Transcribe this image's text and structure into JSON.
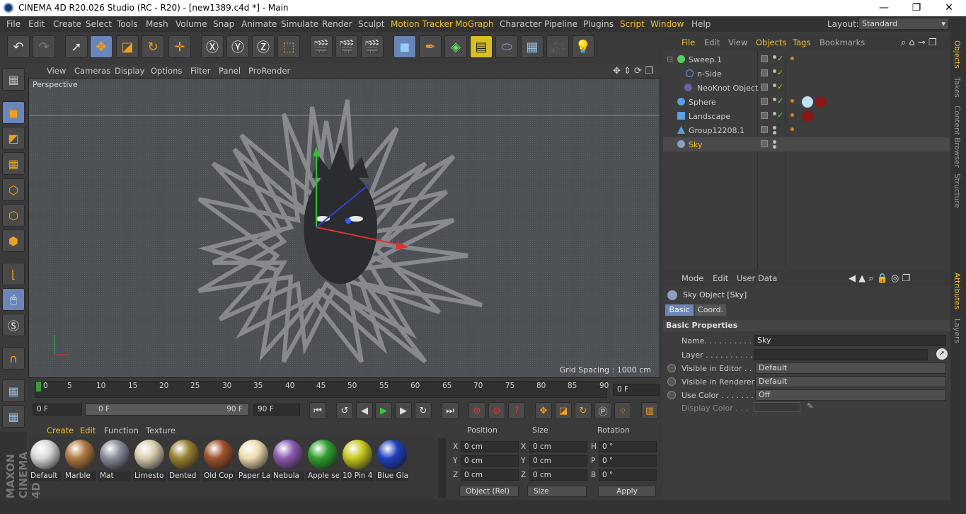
{
  "window": {
    "title": "CINEMA 4D R20.026 Studio (RC - R20) - [new1389.c4d *] - Main",
    "min": "—",
    "max": "❐",
    "close": "✕"
  },
  "menu": [
    "File",
    "Edit",
    "Create",
    "Select",
    "Tools",
    "Mesh",
    "Volume",
    "Snap",
    "Animate",
    "Simulate",
    "Render",
    "Sculpt",
    "Motion Tracker",
    "MoGraph",
    "Character",
    "Pipeline",
    "Plugins",
    "Script",
    "Window",
    "Help"
  ],
  "layout": {
    "label": "Layout:",
    "value": "Standard"
  },
  "viewport": {
    "menu": [
      "View",
      "Cameras",
      "Display",
      "Options",
      "Filter",
      "Panel",
      "ProRender"
    ],
    "label": "Perspective",
    "grid": "Grid Spacing : 1000 cm"
  },
  "timeline": {
    "ticks": [
      "0",
      "5",
      "10",
      "15",
      "20",
      "25",
      "30",
      "35",
      "40",
      "45",
      "50",
      "55",
      "60",
      "65",
      "70",
      "75",
      "80",
      "85",
      "90"
    ],
    "frame": "0 F"
  },
  "transport": {
    "start": "0 F",
    "range_start": "0 F",
    "range_end": "90 F",
    "end": "90 F"
  },
  "materials": {
    "menu": [
      "Create",
      "Edit",
      "Function",
      "Texture"
    ],
    "items": [
      {
        "name": "Default",
        "color": "#d8d8d8"
      },
      {
        "name": "Marble",
        "color": "#b07a40"
      },
      {
        "name": "Mat",
        "color": "#8a8e9c"
      },
      {
        "name": "Limesto",
        "color": "#d8cdb0"
      },
      {
        "name": "Dented",
        "color": "#9a8030"
      },
      {
        "name": "Old Cop",
        "color": "#a0522d"
      },
      {
        "name": "Paper La",
        "color": "#f0dcb0"
      },
      {
        "name": "Nebula",
        "color": "#8a5ab0"
      },
      {
        "name": "Apple se",
        "color": "#30a030"
      },
      {
        "name": "10 Pin 4",
        "color": "#c8c820"
      },
      {
        "name": "Blue Gla",
        "color": "#2040c0"
      }
    ]
  },
  "coords": {
    "headers": [
      "Position",
      "Size",
      "Rotation"
    ],
    "rows": [
      {
        "a": "X",
        "pos": "0 cm",
        "b": "X",
        "size": "0 cm",
        "c": "H",
        "rot": "0 °"
      },
      {
        "a": "Y",
        "pos": "0 cm",
        "b": "Y",
        "size": "0 cm",
        "c": "P",
        "rot": "0 °"
      },
      {
        "a": "Z",
        "pos": "0 cm",
        "b": "Z",
        "size": "0 cm",
        "c": "B",
        "rot": "0 °"
      }
    ],
    "mode": "Object (Rel)",
    "size_mode": "Size",
    "apply": "Apply"
  },
  "objects": {
    "menu": [
      "File",
      "Edit",
      "View",
      "Objects",
      "Tags",
      "Bookmarks"
    ],
    "items": [
      {
        "name": "Sweep.1",
        "color": "#5ad05a"
      },
      {
        "name": "n-Side",
        "color": "#5aa0e0"
      },
      {
        "name": "NeoKnot Object",
        "color": "#7060a0"
      },
      {
        "name": "Sphere",
        "color": "#5aa0e0"
      },
      {
        "name": "Landscape",
        "color": "#5aa0e0"
      },
      {
        "name": "Group12208.1",
        "color": "#5aa0e0"
      },
      {
        "name": "Sky",
        "color": "#8aa0c0"
      }
    ]
  },
  "attributes": {
    "menu": [
      "Mode",
      "Edit",
      "User Data"
    ],
    "object": "Sky Object [Sky]",
    "tabs": [
      "Basic",
      "Coord."
    ],
    "section": "Basic Properties",
    "fields": {
      "name_label": "Name. . . . . . . . . . . .",
      "name": "Sky",
      "layer_label": "Layer . . . . . . . . . . . .",
      "layer": "",
      "vis_editor_label": "Visible in Editor . .",
      "vis_editor": "Default",
      "vis_render_label": "Visible in Renderer",
      "vis_render": "Default",
      "use_color_label": "Use Color . . . . . . .",
      "use_color": "Off",
      "display_color_label": "Display Color . . ."
    }
  },
  "side_tabs": [
    "Objects",
    "Takes",
    "Content Browser",
    "Structure",
    "Attributes",
    "Layers"
  ],
  "brand": "MAXON CINEMA 4D"
}
